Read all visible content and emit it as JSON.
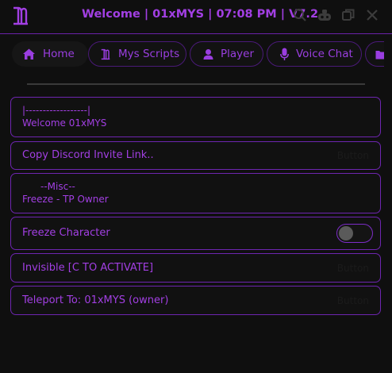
{
  "window": {
    "title": "Welcome | 01xMYS | 07:08 PM | V7.2",
    "accent": "#a23fe3"
  },
  "titlebar_icons": [
    "search-icon",
    "game-controller-icon",
    "restore-icon",
    "close-icon"
  ],
  "tabs": [
    {
      "label": "Home",
      "icon": "home-icon",
      "active": true
    },
    {
      "label": "Mys Scripts",
      "icon": "logo-icon",
      "active": false
    },
    {
      "label": "Player",
      "icon": "person-icon",
      "active": false
    },
    {
      "label": "Voice Chat",
      "icon": "microphone-icon",
      "active": false
    },
    {
      "label": "",
      "icon": "folder-icon",
      "active": false
    }
  ],
  "home": {
    "welcome_line1": "|------------------|",
    "welcome_line2": "Welcome 01xMYS",
    "copy_discord": {
      "label": "Copy Discord Invite Link..",
      "hint": "Button"
    },
    "misc_header": "--Misc--",
    "misc_sub": "Freeze - TP Owner",
    "freeze_character": {
      "label": "Freeze Character",
      "state": false
    },
    "invisible": {
      "label": "Invisible [C TO ACTIVATE]",
      "hint": "Button"
    },
    "teleport": {
      "label": "Teleport To: 01xMYS (owner)",
      "hint": "Button"
    }
  }
}
